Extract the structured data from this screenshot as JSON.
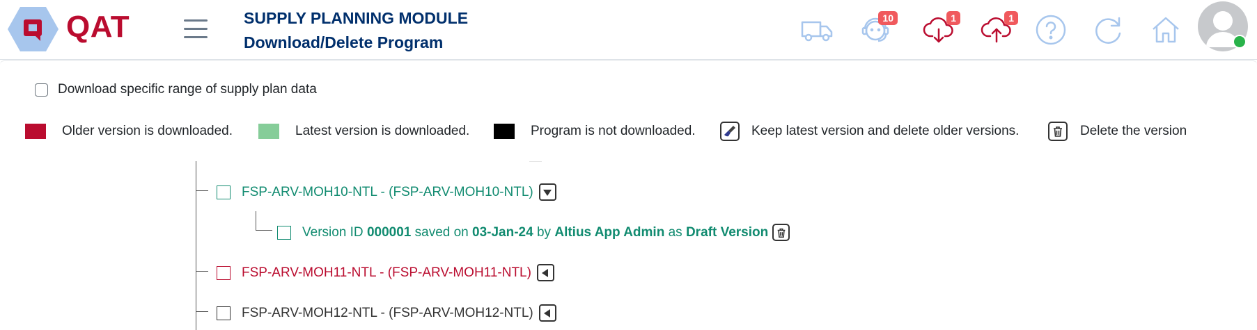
{
  "header": {
    "brand": "QAT",
    "module": "SUPPLY PLANNING MODULE",
    "page": "Download/Delete Program",
    "icons": [
      {
        "name": "truck-icon",
        "badge": ""
      },
      {
        "name": "support-agent-icon",
        "badge": "10"
      },
      {
        "name": "cloud-download-icon",
        "badge": "1"
      },
      {
        "name": "cloud-upload-icon",
        "badge": "1"
      },
      {
        "name": "help-icon",
        "badge": ""
      },
      {
        "name": "refresh-icon",
        "badge": ""
      },
      {
        "name": "home-icon",
        "badge": ""
      }
    ]
  },
  "range": {
    "label": "Download specific range of supply plan data",
    "checked": false
  },
  "legend": {
    "older": "Older version is downloaded.",
    "latest": "Latest version is downloaded.",
    "not_downloaded": "Program is not downloaded.",
    "keep_latest": "Keep latest version and delete older versions.",
    "delete_version": "Delete the version"
  },
  "tree": {
    "programs": [
      {
        "label": "FSP-ARV-MOH10-NTL - (FSP-ARV-MOH10-NTL)",
        "state": "latest",
        "expanded": true
      },
      {
        "label": "FSP-ARV-MOH11-NTL - (FSP-ARV-MOH11-NTL)",
        "state": "older",
        "expanded": false
      },
      {
        "label": "FSP-ARV-MOH12-NTL - (FSP-ARV-MOH12-NTL)",
        "state": "not_downloaded",
        "expanded": false
      }
    ],
    "version": {
      "prefix": "Version ID",
      "id": "000001",
      "saved_on": "saved on",
      "date": "03-Jan-24",
      "by": "by",
      "user": "Altius App Admin",
      "as": "as",
      "type": "Draft Version"
    }
  },
  "colors": {
    "older": "#ba0c2f",
    "latest": "#86cd99",
    "not_downloaded": "#000000",
    "brand": "#ba0c2f",
    "title": "#002f6c",
    "icon": "#a7c6ed",
    "badge": "#f0595d"
  }
}
